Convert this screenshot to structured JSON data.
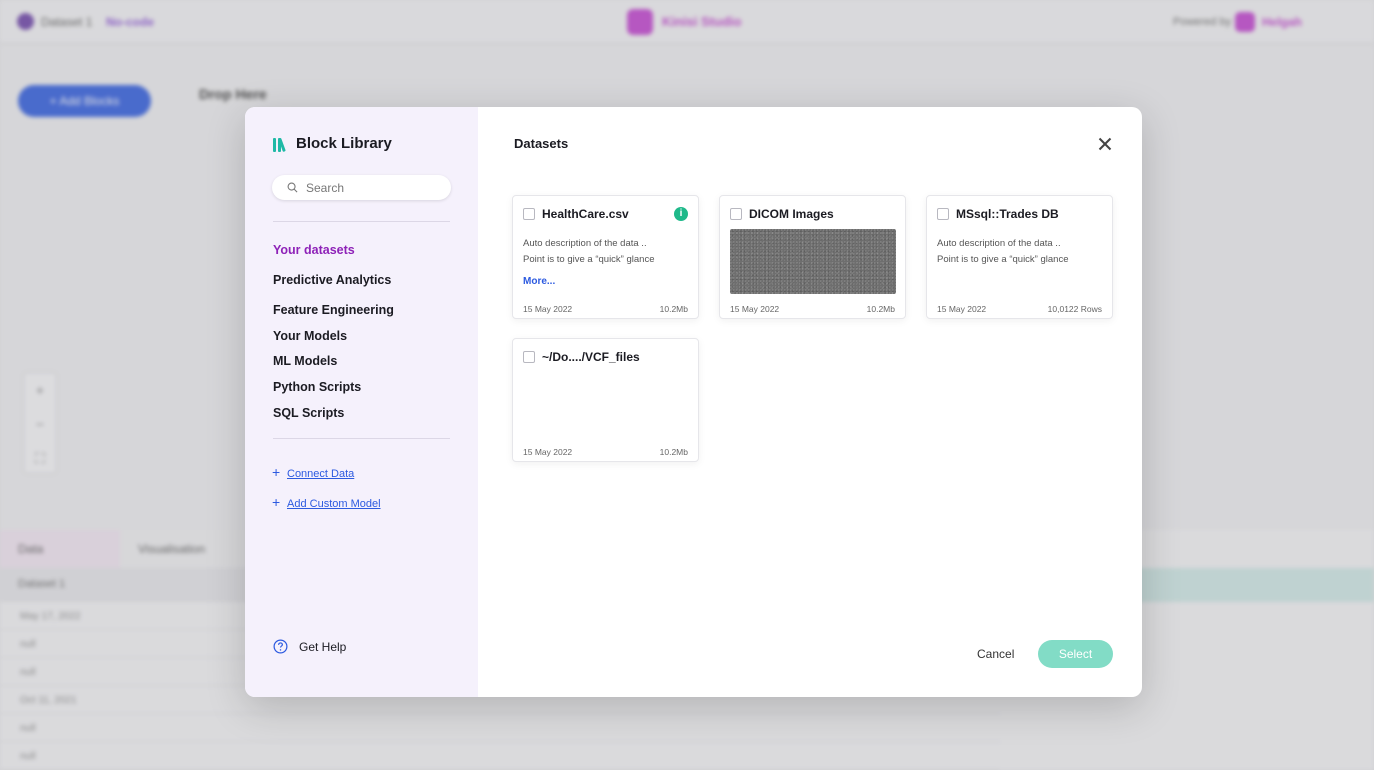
{
  "background": {
    "dataset_label": "Dataset 1",
    "mode_label": "No-code",
    "app_name": "Kinisi Studio",
    "powered_by": "Powered by",
    "powered_brand": "Helgah",
    "add_blocks": "+ Add Blocks",
    "drop_here": "Drop Here",
    "tabs": [
      "Data",
      "Visualisation"
    ],
    "table_header": "Dataset 1",
    "rows": [
      "May 17, 2022",
      "null",
      "null",
      "Oct 11, 2021",
      "null",
      "null"
    ]
  },
  "sidebar": {
    "title": "Block Library",
    "search_placeholder": "Search",
    "nav": [
      {
        "label": "Your datasets",
        "active": true
      },
      {
        "label": "Predictive Analytics"
      },
      {
        "label": "Feature Engineering"
      },
      {
        "label": "Your Models"
      },
      {
        "label": "ML Models"
      },
      {
        "label": "Python Scripts"
      },
      {
        "label": "SQL Scripts"
      }
    ],
    "actions": [
      {
        "label": "Connect Data",
        "icon": "plus-icon"
      },
      {
        "label": "Add Custom Model",
        "icon": "plus-icon"
      }
    ],
    "help": {
      "label": "Get Help",
      "icon": "question-circle-icon"
    }
  },
  "main": {
    "title": "Datasets",
    "close_icon": "close-icon",
    "datasets": [
      {
        "name": "HealthCare.csv",
        "info_badge": "i",
        "description_line1": "Auto description of the data ..",
        "description_line2": "Point is to give a “quick” glance",
        "more": "More...",
        "date": "15 May 2022",
        "size": "10.2Mb"
      },
      {
        "name": "DICOM Images",
        "date": "15 May 2022",
        "size": "10.2Mb"
      },
      {
        "name": "MSsql::Trades DB",
        "description_line1": "Auto description of the data ..",
        "description_line2": "Point is to give a “quick” glance",
        "date": "15 May 2022",
        "size": "10,0122 Rows"
      },
      {
        "name": "~/Do..../VCF_files",
        "date": "15 May 2022",
        "size": "10.2Mb"
      }
    ],
    "cancel": "Cancel",
    "select": "Select"
  },
  "colors": {
    "accent_purple": "#8e22b8",
    "teal": "#1fb9a6",
    "link_blue": "#2c5ae0",
    "select_button": "#82dcc6",
    "sidebar_bg": "#f5f1fc"
  }
}
